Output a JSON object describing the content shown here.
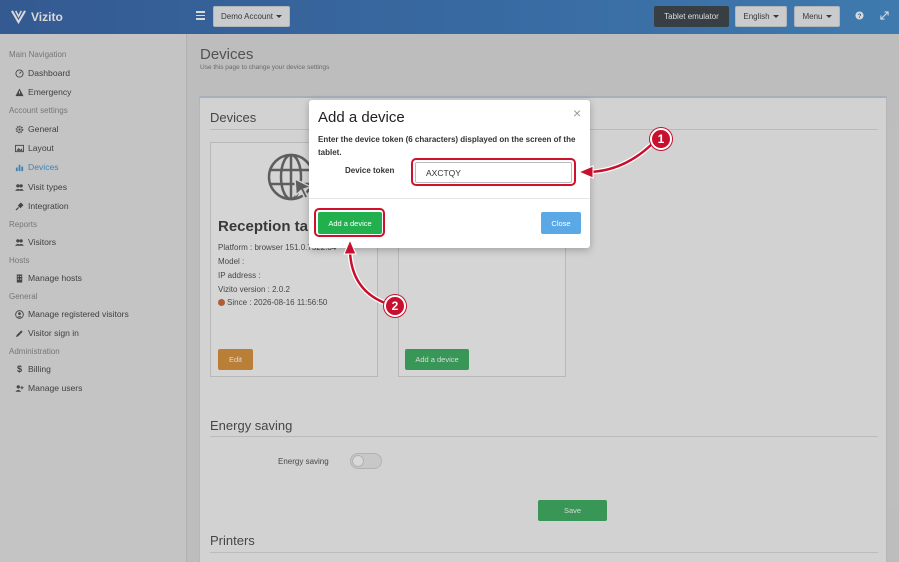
{
  "colors": {
    "topbar": "#1b4f9c",
    "accent": "#2a89c9",
    "green": "#21a34a",
    "orange": "#d5831f",
    "close_blue": "#5aa9e6",
    "highlight": "#d0112b"
  },
  "topbar": {
    "app_name": "Vizito",
    "account_label": "Demo Account",
    "tablet_emulator_label": "Tablet emulator",
    "language_label": "English",
    "menu_label": "Menu",
    "help_icon": "question-icon",
    "fullscreen_icon": "expand-icon"
  },
  "sidebar": {
    "main_nav_heading": "Main Navigation",
    "dashboard": "Dashboard",
    "emergency": "Emergency",
    "account_settings_heading": "Account settings",
    "general": "General",
    "layout": "Layout",
    "devices": "Devices",
    "visit_types": "Visit types",
    "integration": "Integration",
    "reports_heading": "Reports",
    "visitors": "Visitors",
    "hosts_heading": "Hosts",
    "manage_hosts": "Manage hosts",
    "general_heading": "General",
    "manage_registered_visitors": "Manage registered visitors",
    "visitor_sign_in": "Visitor sign in",
    "administration_heading": "Administration",
    "billing": "Billing",
    "manage_users": "Manage users"
  },
  "page": {
    "title": "Devices",
    "subtitle": "Use this page to change your device settings",
    "devices_section": "Devices",
    "device_name": "Reception tabl",
    "platform": "Platform : browser 151.0.7522.34",
    "model": "Model :",
    "ip_address": "IP address :",
    "version": "Vizito version : 2.0.2",
    "since": "Since : 2026-08-16 11:56:50",
    "edit_label": "Edit",
    "add_device_label": "Add a device",
    "energy_section": "Energy saving",
    "energy_label": "Energy saving",
    "energy_saving_on": false,
    "save_label": "Save",
    "printers_section": "Printers"
  },
  "modal": {
    "title": "Add a device",
    "close_symbol": "×",
    "message": "Enter the device token (6 characters) displayed on the screen of the tablet.",
    "token_label": "Device token",
    "token_value": "AXCTQY",
    "add_label": "Add a device",
    "close_label": "Close"
  },
  "annotations": {
    "marker_1": "1",
    "marker_2": "2"
  }
}
